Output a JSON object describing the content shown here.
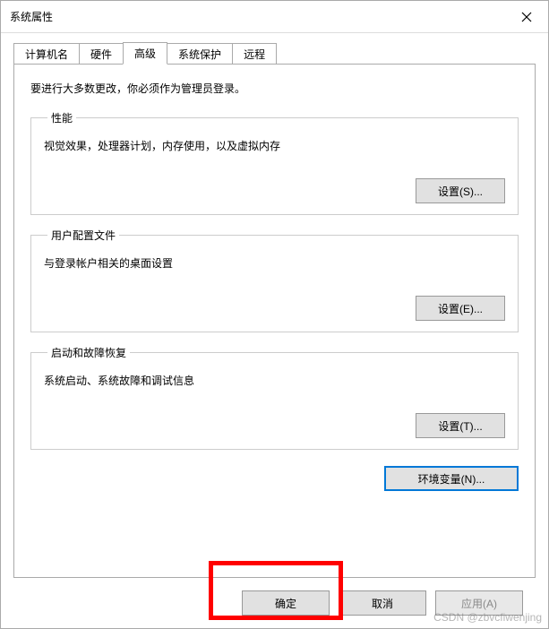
{
  "window": {
    "title": "系统属性"
  },
  "tabs": {
    "computer_name": "计算机名",
    "hardware": "硬件",
    "advanced": "高级",
    "system_protection": "系统保护",
    "remote": "远程"
  },
  "panel": {
    "intro": "要进行大多数更改，你必须作为管理员登录。",
    "performance": {
      "legend": "性能",
      "desc": "视觉效果，处理器计划，内存使用，以及虚拟内存",
      "button": "设置(S)..."
    },
    "profiles": {
      "legend": "用户配置文件",
      "desc": "与登录帐户相关的桌面设置",
      "button": "设置(E)..."
    },
    "startup": {
      "legend": "启动和故障恢复",
      "desc": "系统启动、系统故障和调试信息",
      "button": "设置(T)..."
    },
    "env_button": "环境变量(N)..."
  },
  "footer": {
    "ok": "确定",
    "cancel": "取消",
    "apply": "应用(A)"
  },
  "watermark": "CSDN @zbvcfiwenjing"
}
